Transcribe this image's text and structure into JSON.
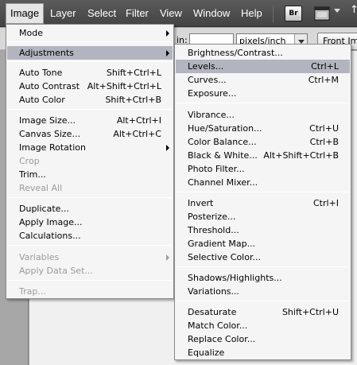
{
  "menubar": {
    "items": [
      "Image",
      "Layer",
      "Select",
      "Filter",
      "View",
      "Window",
      "Help"
    ],
    "bridge_label": "Br",
    "right_glyph": "↑"
  },
  "options_bar": {
    "label": "in:",
    "unit_select": "pixels/inch",
    "front_button": "Front Im"
  },
  "image_menu": {
    "mode": "Mode",
    "adjustments": "Adjustments",
    "auto_tone": {
      "label": "Auto Tone",
      "shortcut": "Shift+Ctrl+L"
    },
    "auto_contrast": {
      "label": "Auto Contrast",
      "shortcut": "Alt+Shift+Ctrl+L"
    },
    "auto_color": {
      "label": "Auto Color",
      "shortcut": "Shift+Ctrl+B"
    },
    "image_size": {
      "label": "Image Size...",
      "shortcut": "Alt+Ctrl+I"
    },
    "canvas_size": {
      "label": "Canvas Size...",
      "shortcut": "Alt+Ctrl+C"
    },
    "image_rotation": "Image Rotation",
    "crop": "Crop",
    "trim": "Trim...",
    "reveal_all": "Reveal All",
    "duplicate": "Duplicate...",
    "apply_image": "Apply Image...",
    "calculations": "Calculations...",
    "variables": "Variables",
    "apply_data_set": "Apply Data Set...",
    "trap": "Trap..."
  },
  "adjustments_menu": {
    "brightness_contrast": {
      "label": "Brightness/Contrast...",
      "shortcut": ""
    },
    "levels": {
      "label": "Levels...",
      "shortcut": "Ctrl+L"
    },
    "curves": {
      "label": "Curves...",
      "shortcut": "Ctrl+M"
    },
    "exposure": {
      "label": "Exposure...",
      "shortcut": ""
    },
    "vibrance": {
      "label": "Vibrance...",
      "shortcut": ""
    },
    "hue_saturation": {
      "label": "Hue/Saturation...",
      "shortcut": "Ctrl+U"
    },
    "color_balance": {
      "label": "Color Balance...",
      "shortcut": "Ctrl+B"
    },
    "black_white": {
      "label": "Black & White...",
      "shortcut": "Alt+Shift+Ctrl+B"
    },
    "photo_filter": {
      "label": "Photo Filter...",
      "shortcut": ""
    },
    "channel_mixer": {
      "label": "Channel Mixer...",
      "shortcut": ""
    },
    "invert": {
      "label": "Invert",
      "shortcut": "Ctrl+I"
    },
    "posterize": {
      "label": "Posterize...",
      "shortcut": ""
    },
    "threshold": {
      "label": "Threshold...",
      "shortcut": ""
    },
    "gradient_map": {
      "label": "Gradient Map...",
      "shortcut": ""
    },
    "selective_color": {
      "label": "Selective Color...",
      "shortcut": ""
    },
    "shadows_highlights": {
      "label": "Shadows/Highlights...",
      "shortcut": ""
    },
    "variations": {
      "label": "Variations...",
      "shortcut": ""
    },
    "desaturate": {
      "label": "Desaturate",
      "shortcut": "Shift+Ctrl+U"
    },
    "match_color": {
      "label": "Match Color...",
      "shortcut": ""
    },
    "replace_color": {
      "label": "Replace Color...",
      "shortcut": ""
    },
    "equalize": {
      "label": "Equalize",
      "shortcut": ""
    }
  },
  "colors": {
    "menubar": "#4f4f4f",
    "menu_bg": "#f5f5f5",
    "highlight": "#b2b4bf",
    "disabled_text": "#9b9b9b"
  }
}
